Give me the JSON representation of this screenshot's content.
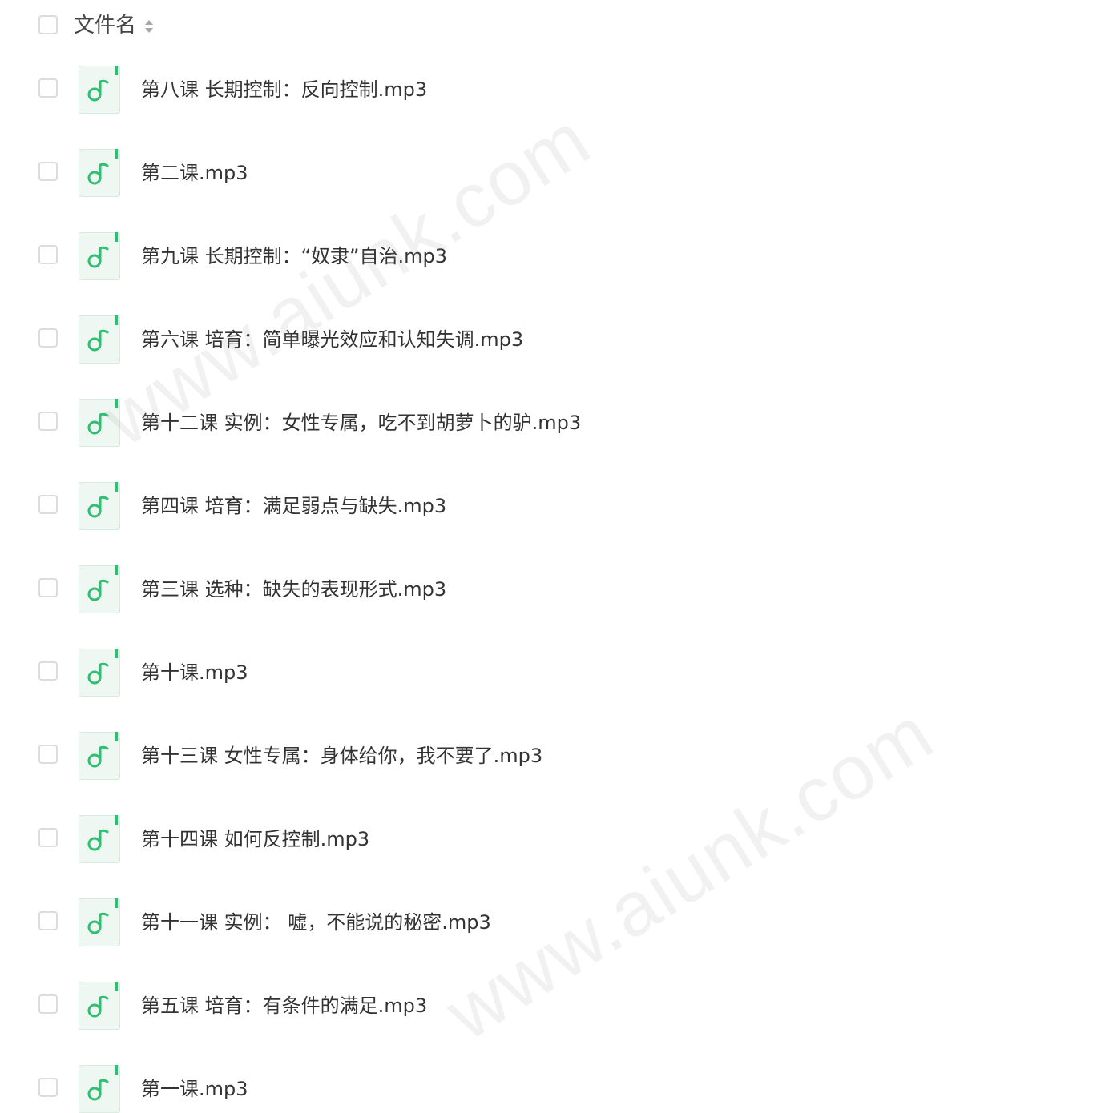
{
  "header": {
    "column_label": "文件名"
  },
  "icons": {
    "file_icon": "music-file-icon",
    "sort_icon": "sort-icon",
    "accent_color": "#2fbf71"
  },
  "files": [
    {
      "name": "第八课 长期控制：反向控制.mp3"
    },
    {
      "name": "第二课.mp3"
    },
    {
      "name": "第九课 长期控制：“奴隶”自治.mp3"
    },
    {
      "name": "第六课 培育：简单曝光效应和认知失调.mp3"
    },
    {
      "name": "第十二课 实例：女性专属，吃不到胡萝卜的驴.mp3"
    },
    {
      "name": "第四课 培育：满足弱点与缺失.mp3"
    },
    {
      "name": "第三课 选种：缺失的表现形式.mp3"
    },
    {
      "name": "第十课.mp3"
    },
    {
      "name": "第十三课 女性专属：身体给你，我不要了.mp3"
    },
    {
      "name": "第十四课 如何反控制.mp3"
    },
    {
      "name": "第十一课 实例： 嘘，不能说的秘密.mp3"
    },
    {
      "name": "第五课 培育：有条件的满足.mp3"
    },
    {
      "name": "第一课.mp3"
    }
  ],
  "watermarks": [
    "www.aiunk.com",
    "www.aiunk.com"
  ]
}
